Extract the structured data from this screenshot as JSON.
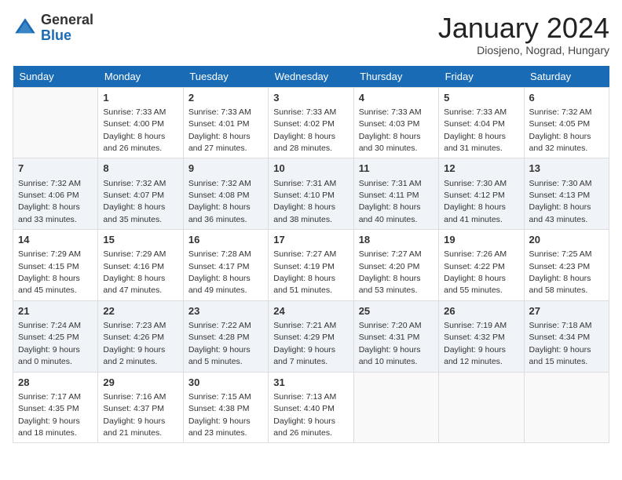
{
  "header": {
    "logo_general": "General",
    "logo_blue": "Blue",
    "month_title": "January 2024",
    "subtitle": "Diosjeno, Nograd, Hungary"
  },
  "days_of_week": [
    "Sunday",
    "Monday",
    "Tuesday",
    "Wednesday",
    "Thursday",
    "Friday",
    "Saturday"
  ],
  "weeks": [
    [
      {
        "day": "",
        "text": ""
      },
      {
        "day": "1",
        "text": "Sunrise: 7:33 AM\nSunset: 4:00 PM\nDaylight: 8 hours\nand 26 minutes."
      },
      {
        "day": "2",
        "text": "Sunrise: 7:33 AM\nSunset: 4:01 PM\nDaylight: 8 hours\nand 27 minutes."
      },
      {
        "day": "3",
        "text": "Sunrise: 7:33 AM\nSunset: 4:02 PM\nDaylight: 8 hours\nand 28 minutes."
      },
      {
        "day": "4",
        "text": "Sunrise: 7:33 AM\nSunset: 4:03 PM\nDaylight: 8 hours\nand 30 minutes."
      },
      {
        "day": "5",
        "text": "Sunrise: 7:33 AM\nSunset: 4:04 PM\nDaylight: 8 hours\nand 31 minutes."
      },
      {
        "day": "6",
        "text": "Sunrise: 7:32 AM\nSunset: 4:05 PM\nDaylight: 8 hours\nand 32 minutes."
      }
    ],
    [
      {
        "day": "7",
        "text": "Sunrise: 7:32 AM\nSunset: 4:06 PM\nDaylight: 8 hours\nand 33 minutes."
      },
      {
        "day": "8",
        "text": "Sunrise: 7:32 AM\nSunset: 4:07 PM\nDaylight: 8 hours\nand 35 minutes."
      },
      {
        "day": "9",
        "text": "Sunrise: 7:32 AM\nSunset: 4:08 PM\nDaylight: 8 hours\nand 36 minutes."
      },
      {
        "day": "10",
        "text": "Sunrise: 7:31 AM\nSunset: 4:10 PM\nDaylight: 8 hours\nand 38 minutes."
      },
      {
        "day": "11",
        "text": "Sunrise: 7:31 AM\nSunset: 4:11 PM\nDaylight: 8 hours\nand 40 minutes."
      },
      {
        "day": "12",
        "text": "Sunrise: 7:30 AM\nSunset: 4:12 PM\nDaylight: 8 hours\nand 41 minutes."
      },
      {
        "day": "13",
        "text": "Sunrise: 7:30 AM\nSunset: 4:13 PM\nDaylight: 8 hours\nand 43 minutes."
      }
    ],
    [
      {
        "day": "14",
        "text": "Sunrise: 7:29 AM\nSunset: 4:15 PM\nDaylight: 8 hours\nand 45 minutes."
      },
      {
        "day": "15",
        "text": "Sunrise: 7:29 AM\nSunset: 4:16 PM\nDaylight: 8 hours\nand 47 minutes."
      },
      {
        "day": "16",
        "text": "Sunrise: 7:28 AM\nSunset: 4:17 PM\nDaylight: 8 hours\nand 49 minutes."
      },
      {
        "day": "17",
        "text": "Sunrise: 7:27 AM\nSunset: 4:19 PM\nDaylight: 8 hours\nand 51 minutes."
      },
      {
        "day": "18",
        "text": "Sunrise: 7:27 AM\nSunset: 4:20 PM\nDaylight: 8 hours\nand 53 minutes."
      },
      {
        "day": "19",
        "text": "Sunrise: 7:26 AM\nSunset: 4:22 PM\nDaylight: 8 hours\nand 55 minutes."
      },
      {
        "day": "20",
        "text": "Sunrise: 7:25 AM\nSunset: 4:23 PM\nDaylight: 8 hours\nand 58 minutes."
      }
    ],
    [
      {
        "day": "21",
        "text": "Sunrise: 7:24 AM\nSunset: 4:25 PM\nDaylight: 9 hours\nand 0 minutes."
      },
      {
        "day": "22",
        "text": "Sunrise: 7:23 AM\nSunset: 4:26 PM\nDaylight: 9 hours\nand 2 minutes."
      },
      {
        "day": "23",
        "text": "Sunrise: 7:22 AM\nSunset: 4:28 PM\nDaylight: 9 hours\nand 5 minutes."
      },
      {
        "day": "24",
        "text": "Sunrise: 7:21 AM\nSunset: 4:29 PM\nDaylight: 9 hours\nand 7 minutes."
      },
      {
        "day": "25",
        "text": "Sunrise: 7:20 AM\nSunset: 4:31 PM\nDaylight: 9 hours\nand 10 minutes."
      },
      {
        "day": "26",
        "text": "Sunrise: 7:19 AM\nSunset: 4:32 PM\nDaylight: 9 hours\nand 12 minutes."
      },
      {
        "day": "27",
        "text": "Sunrise: 7:18 AM\nSunset: 4:34 PM\nDaylight: 9 hours\nand 15 minutes."
      }
    ],
    [
      {
        "day": "28",
        "text": "Sunrise: 7:17 AM\nSunset: 4:35 PM\nDaylight: 9 hours\nand 18 minutes."
      },
      {
        "day": "29",
        "text": "Sunrise: 7:16 AM\nSunset: 4:37 PM\nDaylight: 9 hours\nand 21 minutes."
      },
      {
        "day": "30",
        "text": "Sunrise: 7:15 AM\nSunset: 4:38 PM\nDaylight: 9 hours\nand 23 minutes."
      },
      {
        "day": "31",
        "text": "Sunrise: 7:13 AM\nSunset: 4:40 PM\nDaylight: 9 hours\nand 26 minutes."
      },
      {
        "day": "",
        "text": ""
      },
      {
        "day": "",
        "text": ""
      },
      {
        "day": "",
        "text": ""
      }
    ]
  ]
}
